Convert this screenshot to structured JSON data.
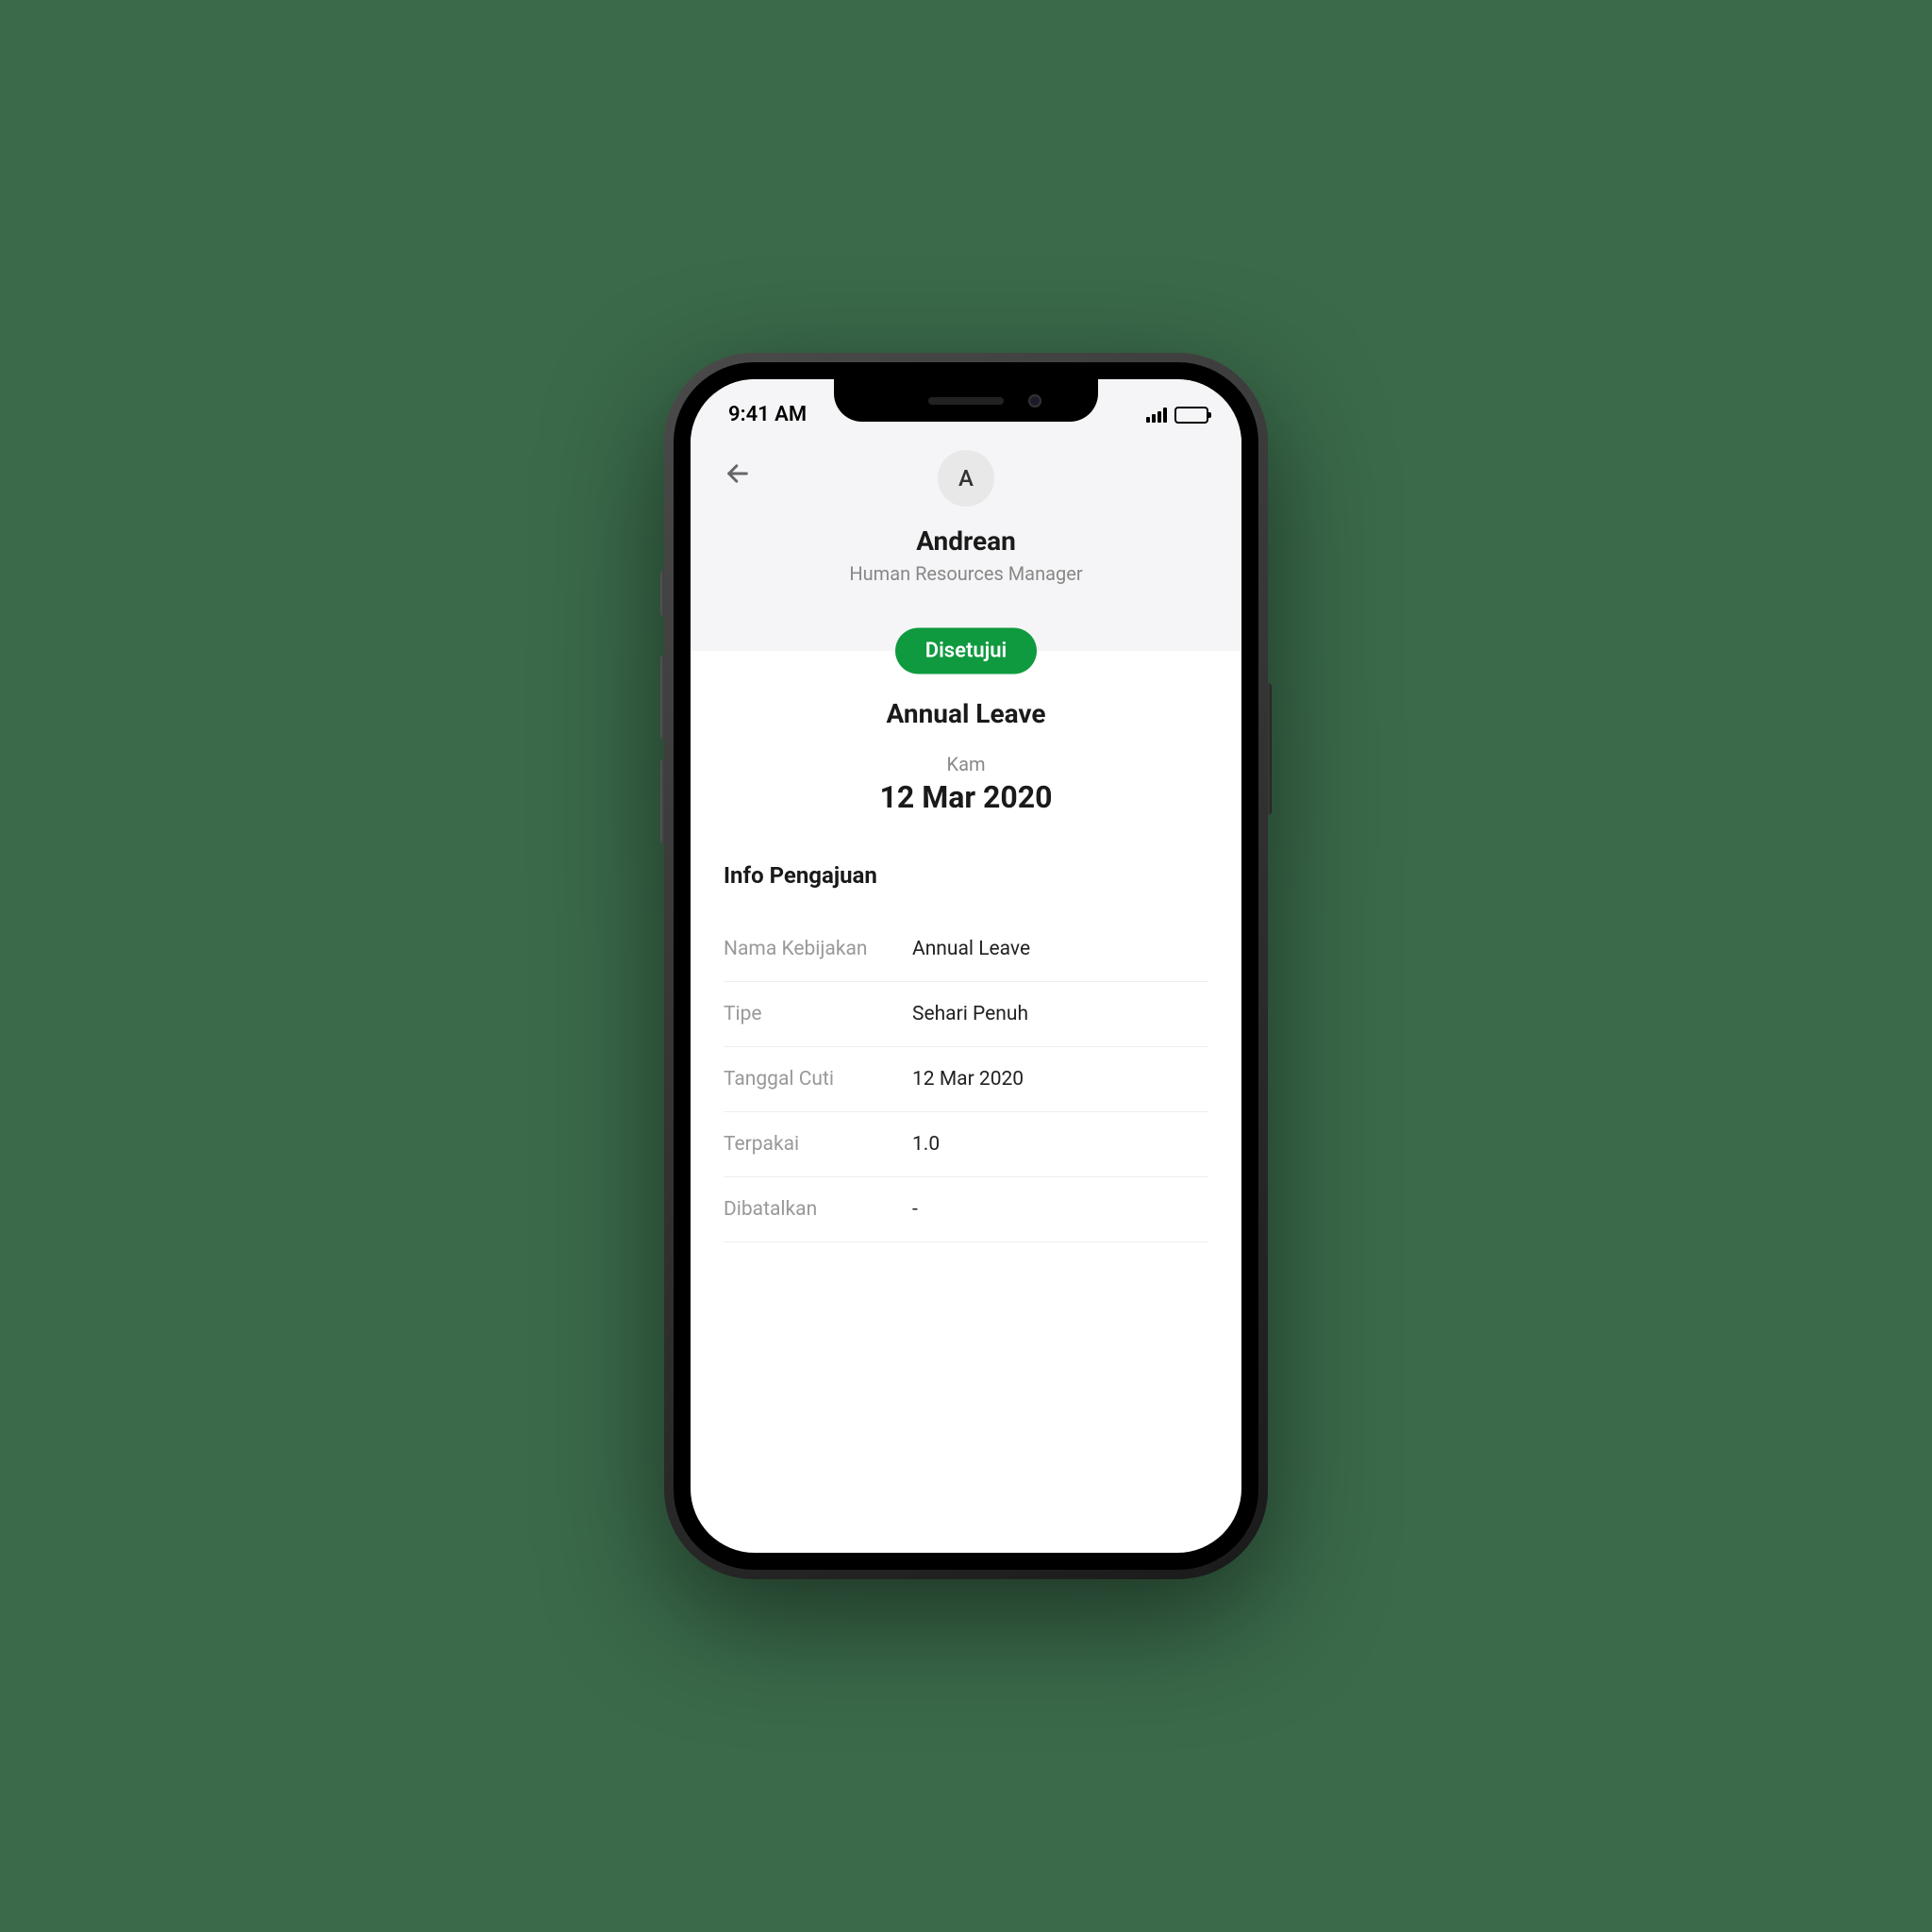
{
  "status_bar": {
    "time": "9:41 AM"
  },
  "header": {
    "avatar_initial": "A",
    "user_name": "Andrean",
    "user_role": "Human Resources Manager"
  },
  "status_badge": "Disetujui",
  "leave": {
    "title": "Annual Leave",
    "day_label": "Kam",
    "date": "12 Mar 2020"
  },
  "info_section": {
    "title": "Info Pengajuan",
    "rows": [
      {
        "label": "Nama Kebijakan",
        "value": "Annual Leave"
      },
      {
        "label": "Tipe",
        "value": "Sehari Penuh"
      },
      {
        "label": "Tanggal Cuti",
        "value": "12 Mar 2020"
      },
      {
        "label": "Terpakai",
        "value": "1.0"
      },
      {
        "label": "Dibatalkan",
        "value": "-"
      }
    ]
  },
  "colors": {
    "accent_green": "#0f9a3f",
    "background": "#3a6a4a"
  }
}
